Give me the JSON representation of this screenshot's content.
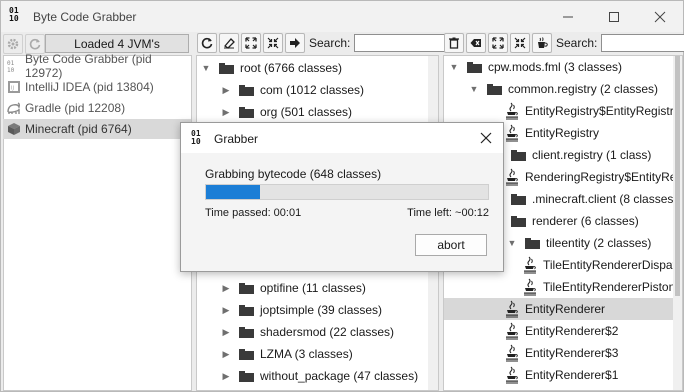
{
  "window": {
    "title": "Byte Code Grabber",
    "icon_text": "01 10"
  },
  "jvm_panel": {
    "load_button": "Loaded 4 JVM's",
    "jvms": [
      {
        "label": "Byte Code Grabber (pid 12972)",
        "icon": "binary-icon"
      },
      {
        "label": "IntelliJ IDEA (pid 13804)",
        "icon": "intellij-icon"
      },
      {
        "label": "Gradle (pid 12208)",
        "icon": "gradle-elephant-icon"
      },
      {
        "label": "Minecraft (pid 6764)",
        "icon": "minecraft-block-icon"
      }
    ]
  },
  "package_panel": {
    "search_label": "Search:",
    "search_value": "",
    "rows": [
      {
        "label": "root (6766 classes)",
        "expanded": true
      },
      {
        "label": "com (1012 classes)",
        "expanded": false
      },
      {
        "label": "org (501 classes)",
        "expanded": false
      },
      {
        "label": "optifine (11 classes)",
        "expanded": false
      },
      {
        "label": "joptsimple (39 classes)",
        "expanded": false
      },
      {
        "label": "shadersmod (22 classes)",
        "expanded": false
      },
      {
        "label": "LZMA (3 classes)",
        "expanded": false
      },
      {
        "label": "without_package (47 classes)",
        "expanded": false
      }
    ]
  },
  "class_panel": {
    "search_label": "Search:",
    "search_value": "",
    "rows": [
      {
        "label": "cpw.mods.fml (3 classes)",
        "kind": "folder"
      },
      {
        "label": "common.registry (2 classes)",
        "kind": "folder"
      },
      {
        "label": "EntityRegistry$EntityRegistra",
        "kind": "class"
      },
      {
        "label": "EntityRegistry",
        "kind": "class"
      },
      {
        "label": "client.registry (1 class)",
        "kind": "folder"
      },
      {
        "label": "RenderingRegistry$EntityRer",
        "kind": "class"
      },
      {
        "label": ".minecraft.client (8 classes)",
        "kind": "folder"
      },
      {
        "label": "renderer (6 classes)",
        "kind": "folder"
      },
      {
        "label": "tileentity (2 classes)",
        "kind": "folder"
      },
      {
        "label": "TileEntityRendererDispatc",
        "kind": "class"
      },
      {
        "label": "TileEntityRendererPiston",
        "kind": "class"
      },
      {
        "label": "EntityRenderer",
        "kind": "class",
        "selected": true
      },
      {
        "label": "EntityRenderer$2",
        "kind": "class"
      },
      {
        "label": "EntityRenderer$3",
        "kind": "class"
      },
      {
        "label": "EntityRenderer$1",
        "kind": "class"
      }
    ]
  },
  "dialog": {
    "title": "Grabber",
    "message": "Grabbing bytecode (648 classes)",
    "progress_fraction": 0.19,
    "time_passed": "Time passed: 00:01",
    "time_left": "Time left: ~00:12",
    "abort_label": "abort"
  },
  "colors": {
    "progress": "#1c7ed6",
    "selection": "#d8d8d8"
  }
}
